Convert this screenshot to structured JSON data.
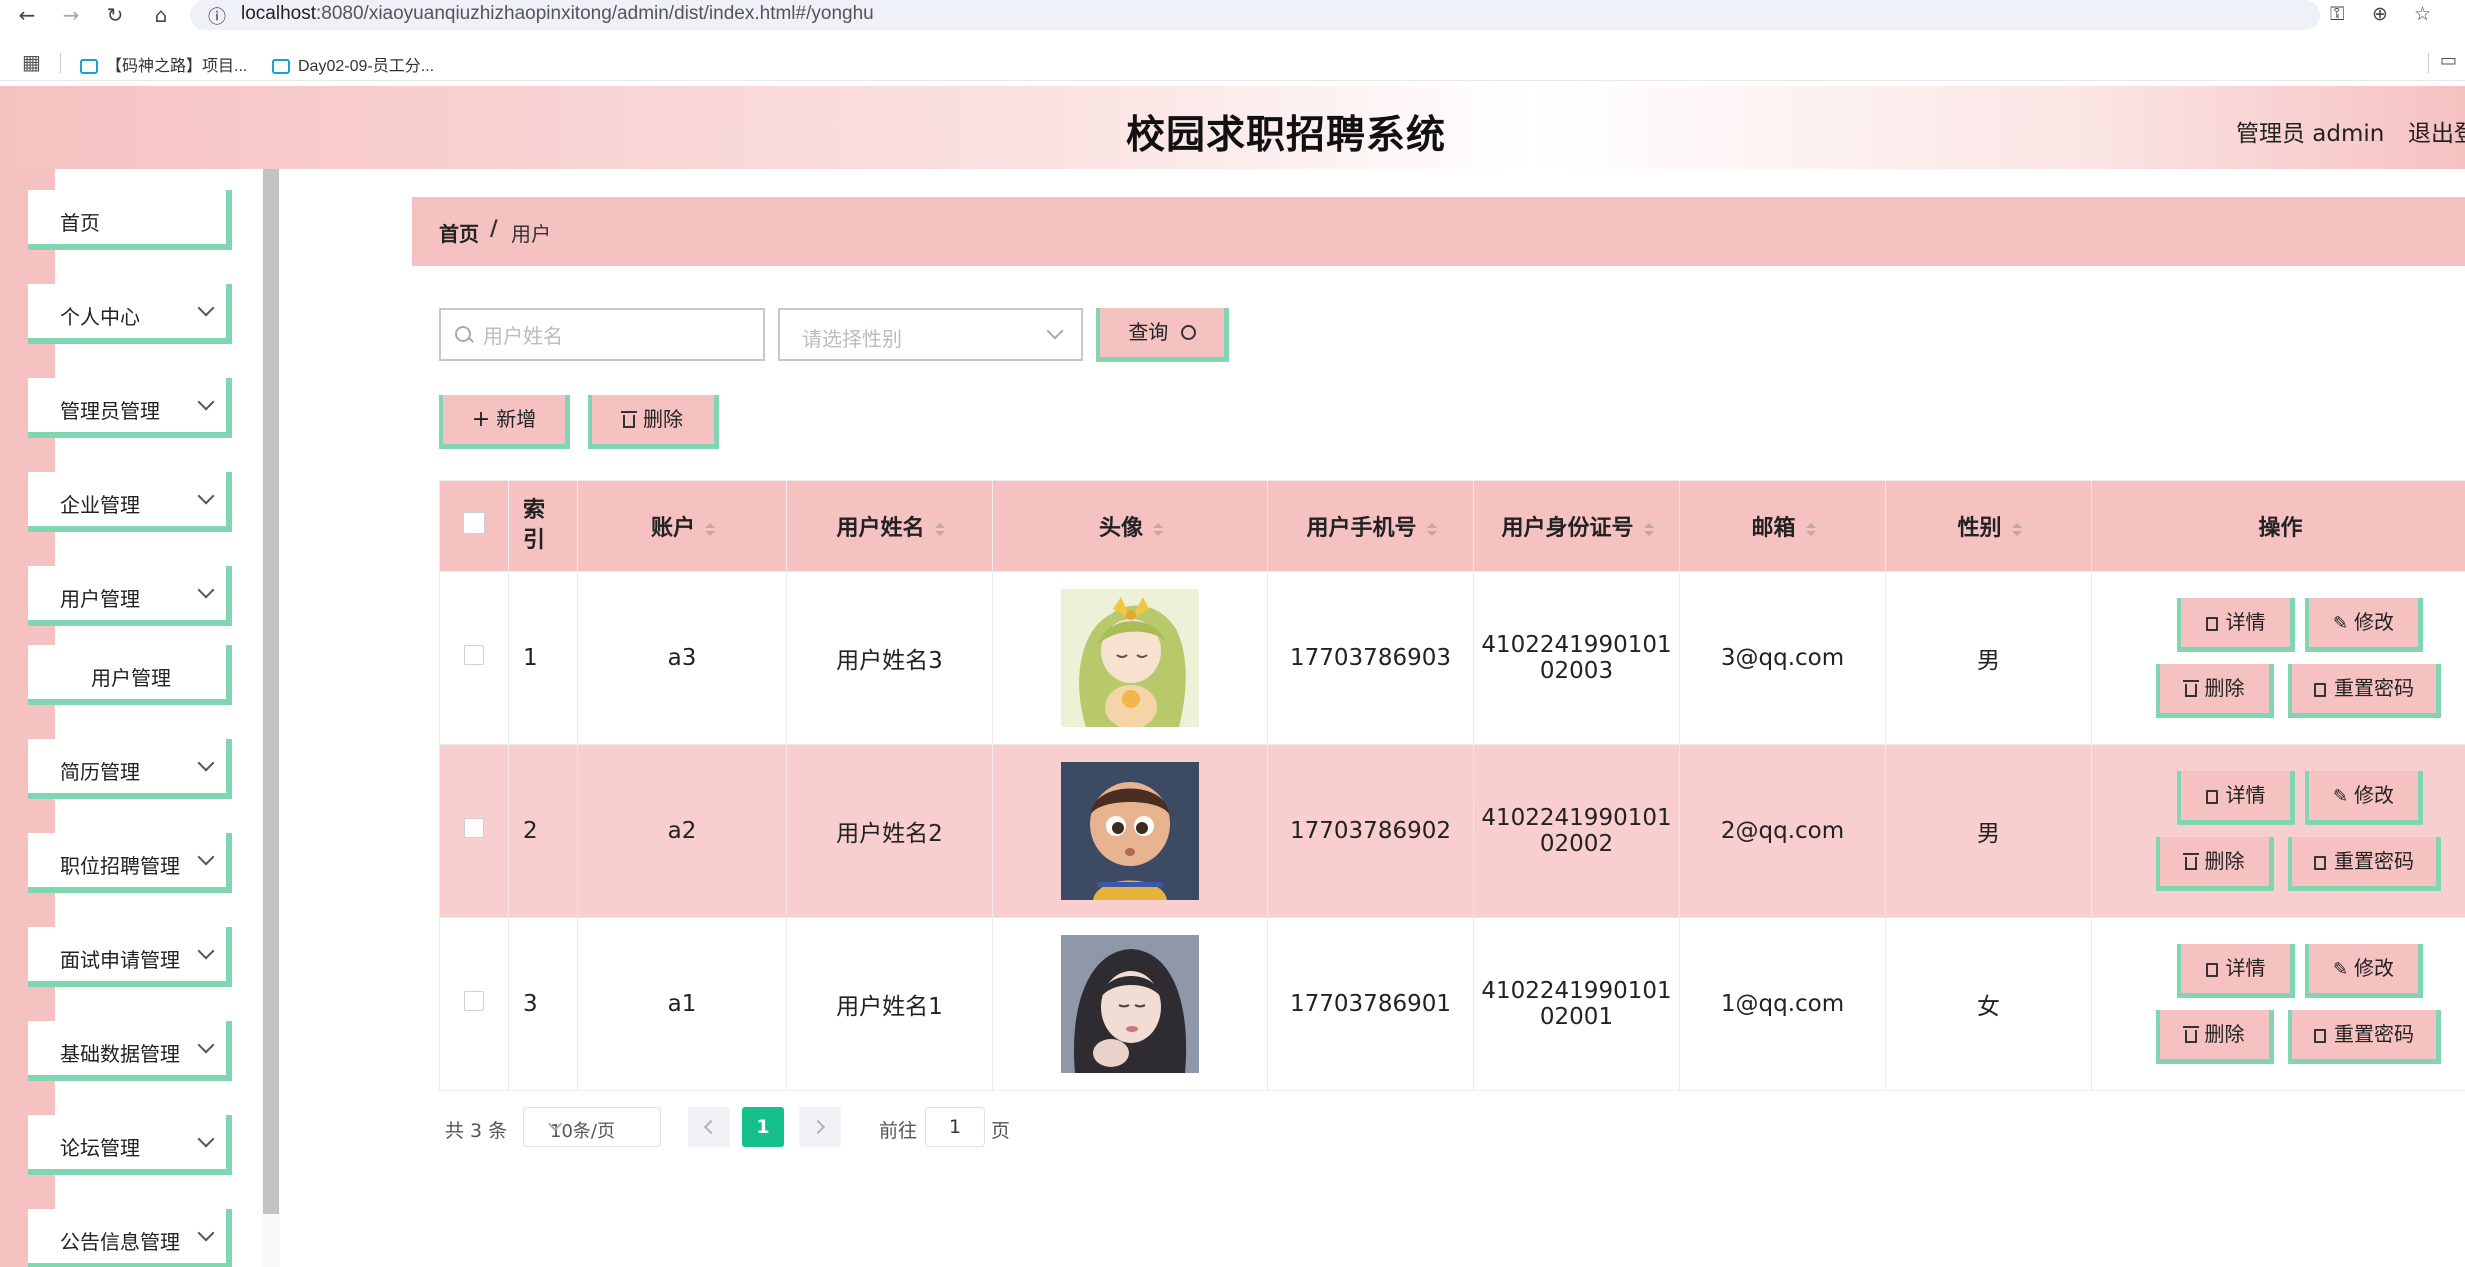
{
  "browser": {
    "url_host": "localhost",
    "url_rest": ":8080/xiaoyuanqiuzhizhaopinxitong/admin/dist/index.html#/yonghu",
    "bookmarks": [
      "【码神之路】项目...",
      "Day02-09-员工分..."
    ]
  },
  "header": {
    "title": "校园求职招聘系统",
    "admin": "管理员 admin",
    "logout": "退出登录"
  },
  "sidebar": {
    "items": [
      {
        "label": "首页"
      },
      {
        "label": "个人中心"
      },
      {
        "label": "管理员管理"
      },
      {
        "label": "企业管理"
      },
      {
        "label": "用户管理"
      },
      {
        "label": "用户管理"
      },
      {
        "label": "简历管理"
      },
      {
        "label": "职位招聘管理"
      },
      {
        "label": "面试申请管理"
      },
      {
        "label": "基础数据管理"
      },
      {
        "label": "论坛管理"
      },
      {
        "label": "公告信息管理"
      }
    ]
  },
  "breadcrumb": {
    "home": "首页",
    "separator": "/",
    "current": "用户"
  },
  "search": {
    "name_placeholder": "用户姓名",
    "gender_placeholder": "请选择性别",
    "query_label": "查询"
  },
  "toolbar": {
    "add_label": "新增",
    "delete_label": "删除"
  },
  "table": {
    "headers": {
      "index": "索引",
      "account": "账户",
      "name": "用户姓名",
      "avatar": "头像",
      "phone": "用户手机号",
      "idcard": "用户身份证号",
      "email": "邮箱",
      "gender": "性别",
      "actions": "操作"
    },
    "rows": [
      {
        "index": "1",
        "account": "a3",
        "name": "用户姓名3",
        "phone": "17703786903",
        "idcard_1": "4102241990101",
        "idcard_2": "02003",
        "email": "3@qq.com",
        "gender": "男",
        "avatar": "anime-girl-avatar"
      },
      {
        "index": "2",
        "account": "a2",
        "name": "用户姓名2",
        "phone": "17703786902",
        "idcard_1": "4102241990101",
        "idcard_2": "02002",
        "email": "2@qq.com",
        "gender": "男",
        "avatar": "cartoon-boy-avatar"
      },
      {
        "index": "3",
        "account": "a1",
        "name": "用户姓名1",
        "phone": "17703786901",
        "idcard_1": "4102241990101",
        "idcard_2": "02001",
        "email": "1@qq.com",
        "gender": "女",
        "avatar": "girl-photo-avatar"
      }
    ],
    "row_actions": {
      "detail": "详情",
      "edit": "修改",
      "delete": "删除",
      "reset": "重置密码"
    }
  },
  "pagination": {
    "total": "共 3 条",
    "page_size": "10条/页",
    "current_page": "1",
    "goto_label": "前往",
    "goto_value": "1",
    "page_unit": "页"
  },
  "colors": {
    "pink": "#f6c1c1",
    "mint": "#7fd6b0",
    "active_page": "#16c08a"
  }
}
